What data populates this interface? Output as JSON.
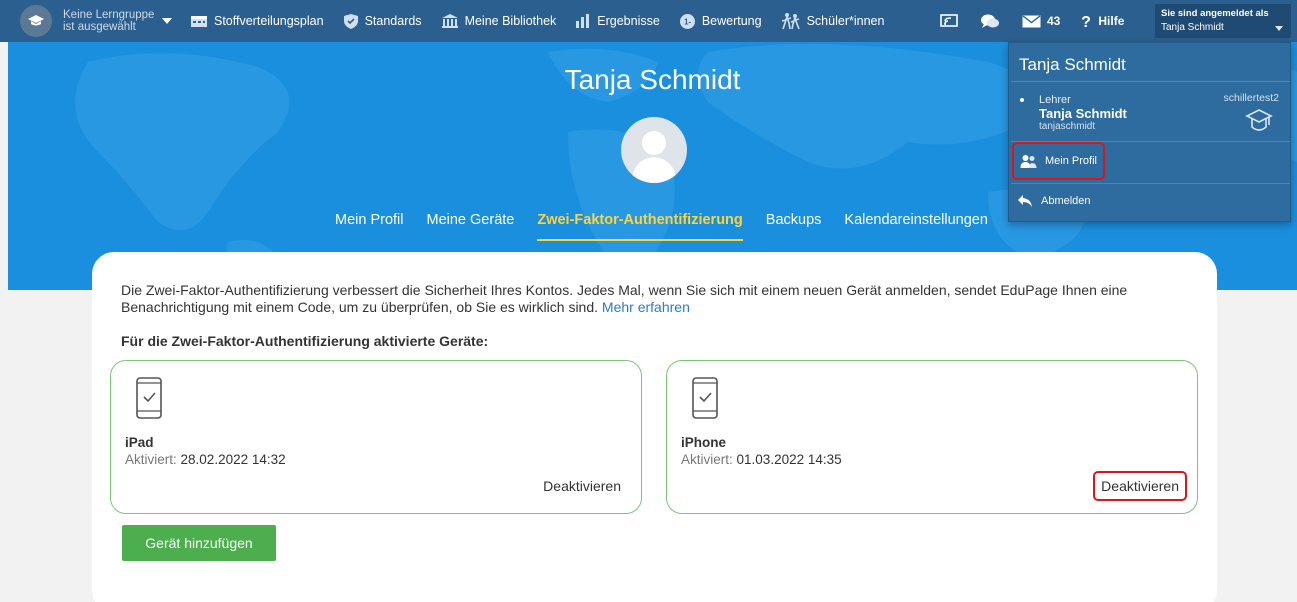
{
  "topbar": {
    "group_line1": "Keine Lerngruppe",
    "group_line2": "ist ausgewählt",
    "nav": [
      {
        "label": "Stoffverteilungsplan",
        "icon": "calendar-icon"
      },
      {
        "label": "Standards",
        "icon": "shield-icon"
      },
      {
        "label": "Meine Bibliothek",
        "icon": "library-icon"
      },
      {
        "label": "Ergebnisse",
        "icon": "bar-chart-icon"
      },
      {
        "label": "Bewertung",
        "icon": "grade-icon"
      },
      {
        "label": "Schüler*innen",
        "icon": "students-icon"
      }
    ],
    "messages_count": "43",
    "help_label": "Hilfe",
    "signed_in_label": "Sie sind angemeldet als",
    "signed_in_user": "Tanja Schmidt"
  },
  "hero": {
    "title": "Tanja Schmidt",
    "tabs": [
      {
        "label": "Mein Profil",
        "active": false
      },
      {
        "label": "Meine Geräte",
        "active": false
      },
      {
        "label": "Zwei-Faktor-Authentifizierung",
        "active": true
      },
      {
        "label": "Backups",
        "active": false
      },
      {
        "label": "Kalendareinstellungen",
        "active": false
      }
    ]
  },
  "content": {
    "intro_text": "Die Zwei-Faktor-Authentifizierung verbessert die Sicherheit Ihres Kontos. Jedes Mal, wenn Sie sich mit einem neuen Gerät anmelden, sendet EduPage Ihnen eine Benachrichtigung mit einem Code, um zu überprüfen, ob Sie es wirklich sind.",
    "learn_more": "Mehr erfahren",
    "devices_title": "Für die Zwei-Faktor-Authentifizierung aktivierte Geräte:",
    "activated_label": "Aktiviert:",
    "devices": [
      {
        "name": "iPad",
        "activated": "28.02.2022 14:32",
        "action": "Deaktivieren"
      },
      {
        "name": "iPhone",
        "activated": "01.03.2022 14:35",
        "action": "Deaktivieren"
      }
    ],
    "add_device": "Gerät hinzufügen"
  },
  "dropdown": {
    "title": "Tanja Schmidt",
    "role": "Lehrer",
    "name": "Tanja Schmidt",
    "login": "tanjaschmidt",
    "school": "schillertest2",
    "my_profile": "Mein Profil",
    "logout": "Abmelden"
  },
  "colors": {
    "topbar": "#2b5f8f",
    "hero": "#1a8fde",
    "active_tab": "#ffd43b",
    "device_border": "#7cc576",
    "primary_button": "#4cae4c",
    "highlight": "#d9161c",
    "link": "#2c7bc7"
  }
}
